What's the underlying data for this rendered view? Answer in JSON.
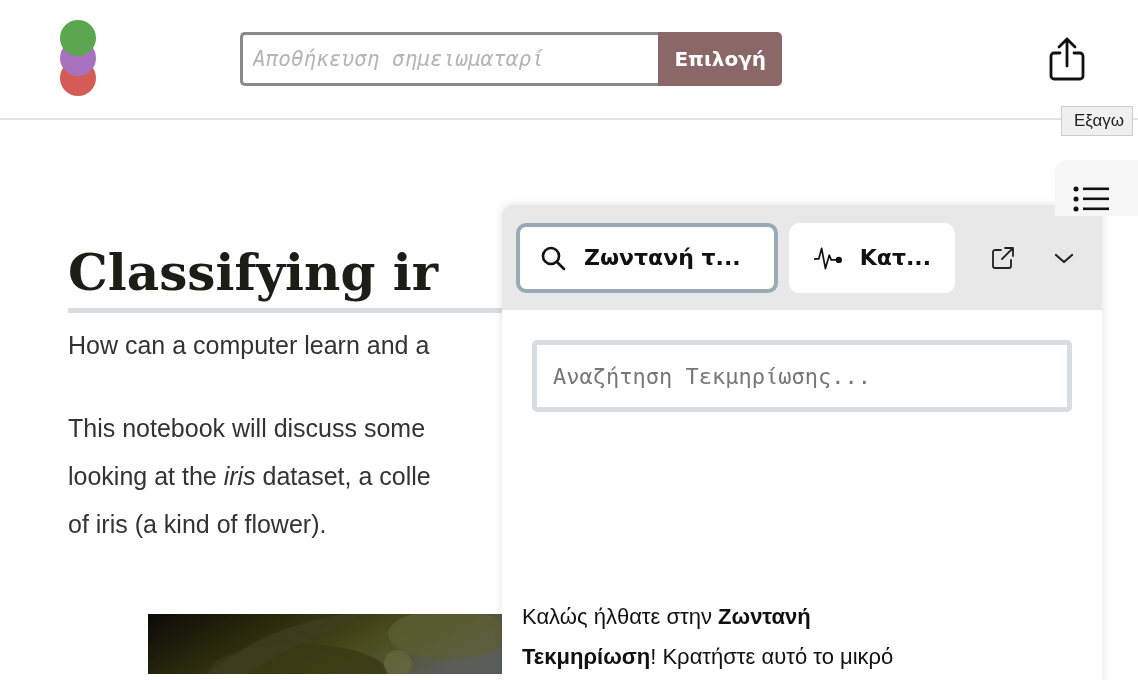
{
  "header": {
    "notebook_field": {
      "placeholder": "Αποθήκευση σημειωματαρί"
    },
    "choose_button": "Επιλογή",
    "share_tooltip": "Εξαγω"
  },
  "article": {
    "title": "Classifying ir",
    "subtitle": "How can a computer learn and a",
    "paragraph_lines": [
      "This notebook will discuss some",
      "looking at the *iris* dataset, a colle",
      "of iris (a kind of flower)."
    ]
  },
  "live_docs_panel": {
    "tabs": [
      {
        "kind": "search",
        "label": "Ζωντανή τ...",
        "selected": true
      },
      {
        "kind": "activity",
        "label": "Κατ...",
        "selected": false
      }
    ],
    "search": {
      "placeholder": "Αναζήτηση Τεκμηρίωσης..."
    },
    "welcome_lines": [
      "Καλώς ήλθατε στην **Ζωντανή**",
      "**Τεκμηρίωση**! Κρατήστε αυτό το μικρό"
    ]
  }
}
